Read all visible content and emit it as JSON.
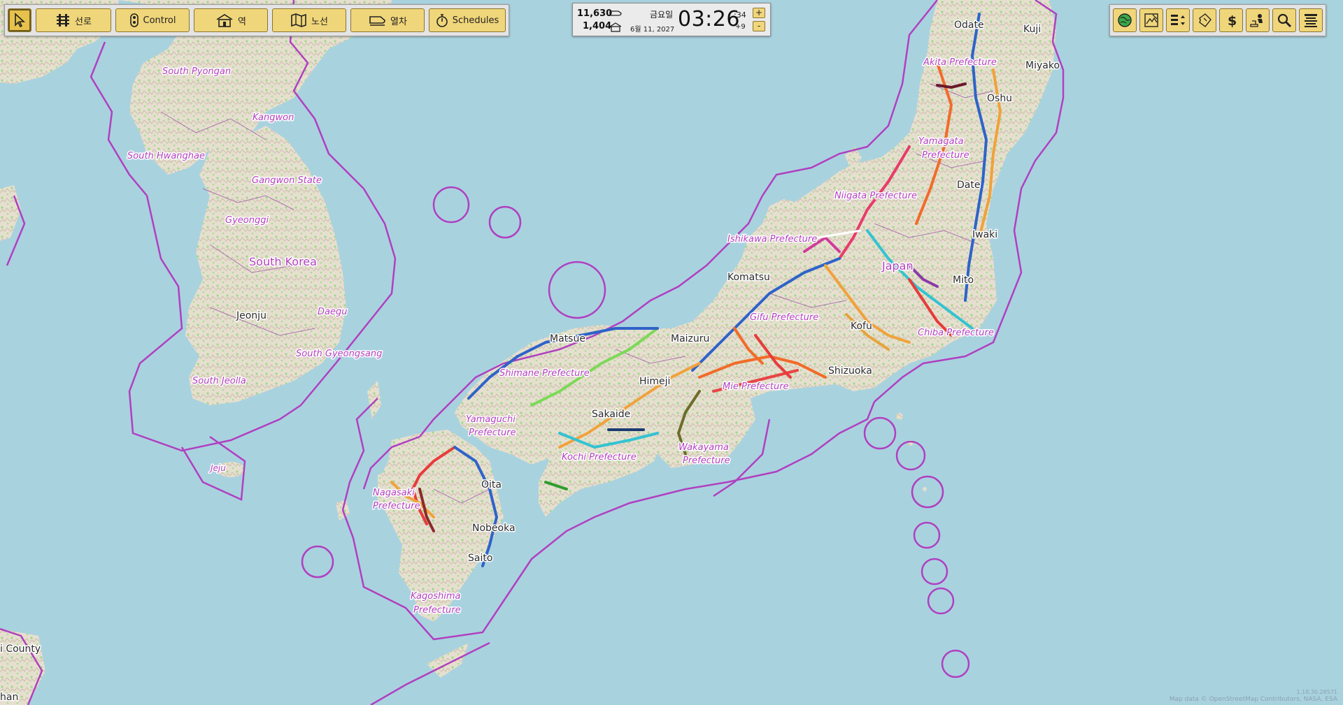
{
  "toolbar_left": {
    "select_tool": "select-pointer-icon",
    "tracks": "선로",
    "control": "Control",
    "stations": "역",
    "lines": "노선",
    "trains": "열차",
    "schedules": "Schedules"
  },
  "status": {
    "money": "11,630",
    "passengers": "1,404",
    "weekday": "금요일",
    "date": "6월 11, 2027",
    "time": "03:26",
    "seconds": ":34",
    "speed": "+9",
    "speed_up": "+",
    "speed_down": "-"
  },
  "toolbar_right": [
    "world-map-icon",
    "terrain-editor-icon",
    "layers-icon",
    "ticket-icon",
    "finance-icon",
    "passenger-flow-icon",
    "search-icon",
    "menu-icon"
  ],
  "map": {
    "cities": [
      "Odate",
      "Kuji",
      "Miyako",
      "Oshu",
      "Date",
      "Iwaki",
      "Mito",
      "Kofu",
      "Shizuoka",
      "Komatsu",
      "Maizuru",
      "Matsue",
      "Himeji",
      "Sakaide",
      "Oita",
      "Nobeoka",
      "Saito",
      "Jeonju",
      "Jeju",
      "i County",
      "han"
    ],
    "regions": [
      "Akita Prefecture",
      "Yamagata",
      "Prefecture",
      "Niigata Prefecture",
      "Ishikawa Prefecture",
      "Gifu Prefecture",
      "Chiba Prefecture",
      "Mie Prefecture",
      "Shimane Prefecture",
      "Yamaguchi",
      "Prefecture",
      "Kochi Prefecture",
      "Wakayama",
      "Prefecture",
      "Nagasaki",
      "Prefecture",
      "Kagoshima",
      "Prefecture",
      "South Pyongan",
      "Kangwon",
      "South Hwanghae",
      "Gangwon State",
      "Gyeonggi",
      "Daegu",
      "South Gyeongsang",
      "South Jeolla"
    ],
    "countries": [
      "Japan",
      "South Korea"
    ],
    "water_color": "#a9d2df",
    "land_color": "#e9e2d4",
    "border_color": "#b040c0"
  },
  "footer": {
    "version": "1.18.30.28571",
    "attribution": "Map data © OpenStreetMap Contributors, NASA, ESA"
  }
}
